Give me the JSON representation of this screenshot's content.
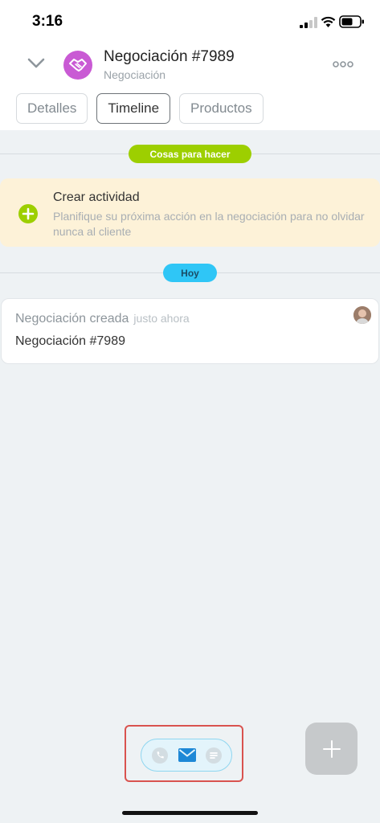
{
  "status_bar": {
    "time": "3:16"
  },
  "header": {
    "title": "Negociación #7989",
    "subtitle": "Negociación",
    "avatar_color": "#c95ad4"
  },
  "tabs": [
    {
      "label": "Detalles",
      "active": false
    },
    {
      "label": "Timeline",
      "active": true
    },
    {
      "label": "Productos",
      "active": false
    }
  ],
  "timeline": {
    "todo_label": "Cosas para hacer",
    "create_activity": {
      "title": "Crear actividad",
      "description": "Planifique su próxima acción en la negociación para no olvidar nunca al cliente"
    },
    "today_label": "Hoy",
    "event": {
      "title": "Negociación creada",
      "time": "justo ahora",
      "body": "Negociación #7989"
    }
  },
  "bottom": {
    "icons": [
      "phone-icon",
      "mail-icon",
      "chat-icon"
    ],
    "add_icon": "plus-icon"
  },
  "colors": {
    "accent_green": "#9dcf00",
    "accent_blue": "#2fc6f6",
    "highlight": "#d9534f"
  }
}
